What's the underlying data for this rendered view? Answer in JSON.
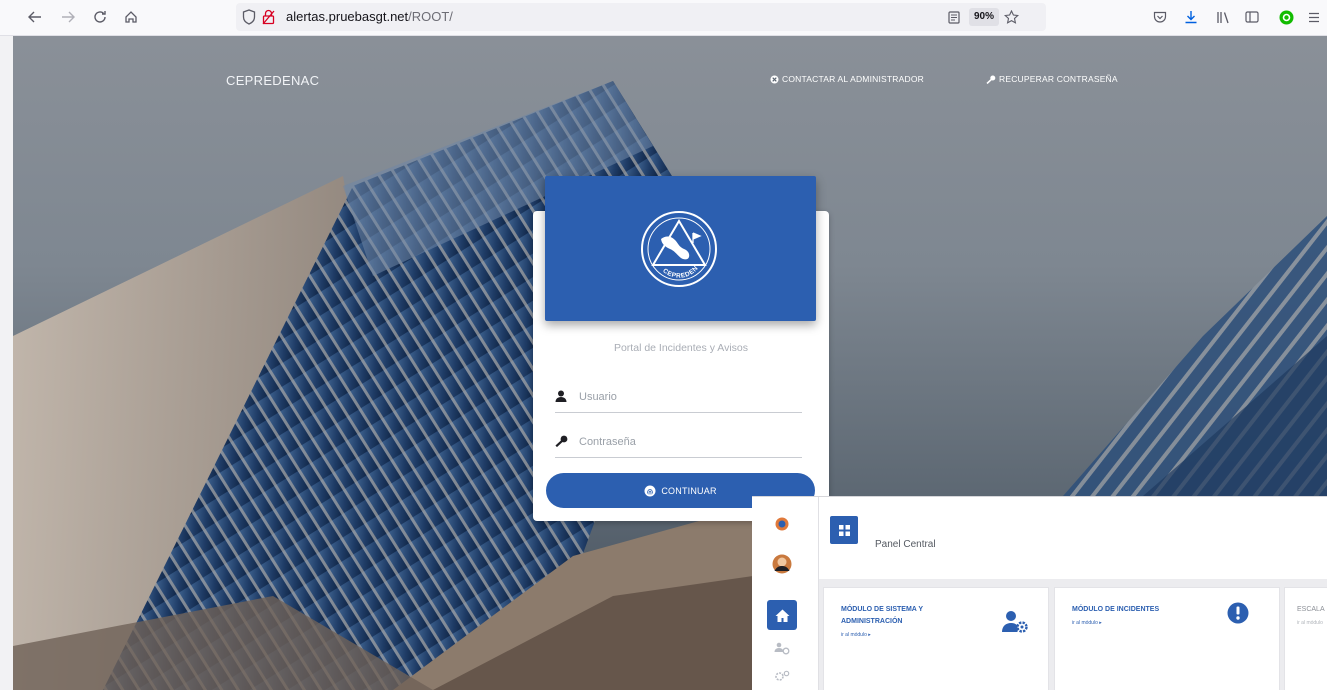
{
  "browser": {
    "url_host": "alertas.pruebasgt.net",
    "url_path": "/ROOT/",
    "zoom": "90%"
  },
  "nav": {
    "brand": "CEPREDENAC",
    "contact_admin": "CONTACTAR AL ADMINISTRADOR",
    "recover_password": "RECUPERAR CONTRASEÑA"
  },
  "login": {
    "logo_text": "CEPREDENAC",
    "subtitle": "Portal de Incidentes y Avisos",
    "username_placeholder": "Usuario",
    "password_placeholder": "Contraseña",
    "continue_label": "CONTINUAR",
    "accent_color": "#2c5fb0"
  },
  "dashboard": {
    "panel_title": "Panel Central",
    "modules": [
      {
        "title": "MÓDULO DE SISTEMA Y ADMINISTRACIÓN",
        "link": "ir al módulo ▸",
        "icon": "user-gear-icon"
      },
      {
        "title": "MÓDULO DE INCIDENTES",
        "link": "ir al módulo ▸",
        "icon": "alert-circle-icon"
      },
      {
        "title": "ESCALA",
        "link": "ir al módulo",
        "icon": ""
      }
    ]
  }
}
